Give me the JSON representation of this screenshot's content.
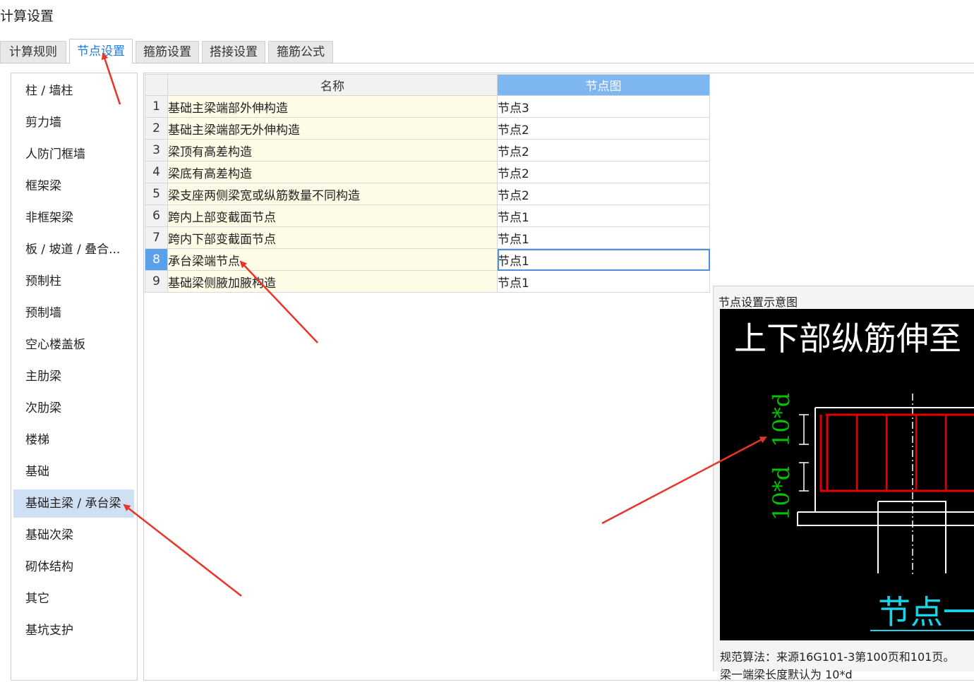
{
  "window": {
    "title": "计算设置"
  },
  "tabs": [
    {
      "label": "计算规则",
      "active": false
    },
    {
      "label": "节点设置",
      "active": true
    },
    {
      "label": "箍筋设置",
      "active": false
    },
    {
      "label": "搭接设置",
      "active": false
    },
    {
      "label": "箍筋公式",
      "active": false
    }
  ],
  "sidebar": {
    "items": [
      {
        "label": "柱 / 墙柱"
      },
      {
        "label": "剪力墙"
      },
      {
        "label": "人防门框墙"
      },
      {
        "label": "框架梁"
      },
      {
        "label": "非框架梁"
      },
      {
        "label": "板 / 坡道 / 叠合..."
      },
      {
        "label": "预制柱"
      },
      {
        "label": "预制墙"
      },
      {
        "label": "空心楼盖板"
      },
      {
        "label": "主肋梁"
      },
      {
        "label": "次肋梁"
      },
      {
        "label": "楼梯"
      },
      {
        "label": "基础"
      },
      {
        "label": "基础主梁 / 承台梁",
        "selected": true
      },
      {
        "label": "基础次梁"
      },
      {
        "label": "砌体结构"
      },
      {
        "label": "其它"
      },
      {
        "label": "基坑支护"
      }
    ]
  },
  "grid": {
    "columns": {
      "name": "名称",
      "node": "节点图"
    },
    "rows": [
      {
        "index": "1",
        "name": "基础主梁端部外伸构造",
        "node": "节点3"
      },
      {
        "index": "2",
        "name": "基础主梁端部无外伸构造",
        "node": "节点2"
      },
      {
        "index": "3",
        "name": "梁顶有高差构造",
        "node": "节点2"
      },
      {
        "index": "4",
        "name": "梁底有高差构造",
        "node": "节点2"
      },
      {
        "index": "5",
        "name": "梁支座两侧梁宽或纵筋数量不同构造",
        "node": "节点2"
      },
      {
        "index": "6",
        "name": "跨内上部变截面节点",
        "node": "节点1"
      },
      {
        "index": "7",
        "name": "跨内下部变截面节点",
        "node": "节点1"
      },
      {
        "index": "8",
        "name": "承台梁端节点",
        "node": "节点1",
        "selected": true
      },
      {
        "index": "9",
        "name": "基础梁侧腋加腋构造",
        "node": "节点1"
      }
    ]
  },
  "preview": {
    "label": "节点设置示意图",
    "drawing": {
      "heading": "上下部纵筋伸至",
      "dim_upper": "10*d",
      "dim_lower": "10*d",
      "caption": "节点一"
    },
    "rule_text": "规范算法：来源16G101-3第100页和101页。",
    "rule_text2": "梁一端梁长度默认为 10*d"
  },
  "colors": {
    "accent": "#1e7be0",
    "header_selected": "#7db6f1",
    "sidebar_selected": "#cfe0f5",
    "name_cell_bg": "#fefbe6",
    "drawing_bg": "#000000",
    "rebar_red": "#e00000",
    "dim_green": "#00c000",
    "caption_cyan": "#19d3e8",
    "annotation_red": "#e8352a"
  }
}
